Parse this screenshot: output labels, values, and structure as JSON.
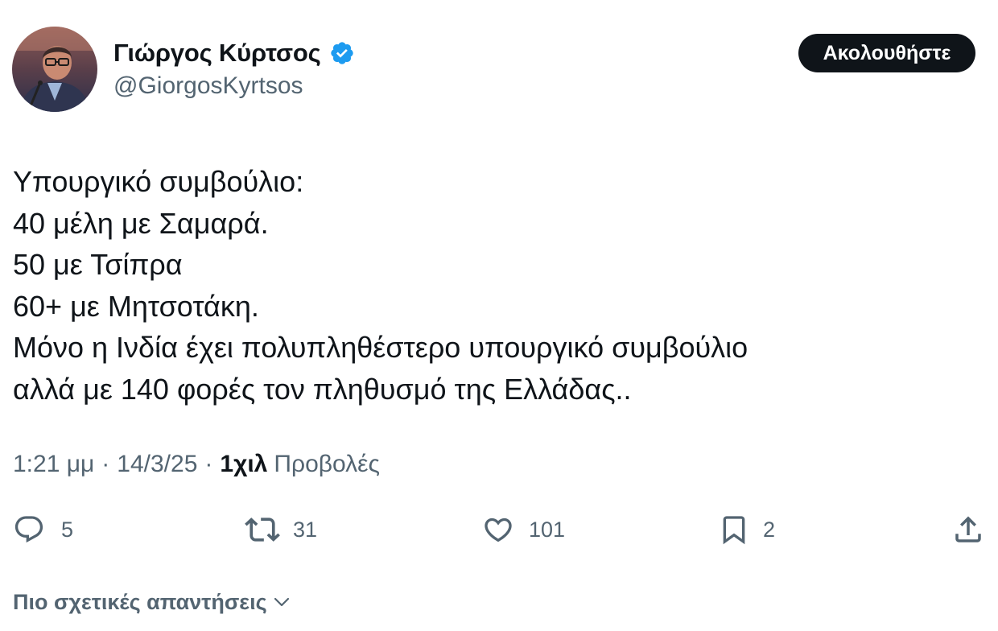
{
  "author": {
    "display_name": "Γιώργος Κύρτσος",
    "handle": "@GiorgosKyrtsos",
    "verified": true,
    "verified_color": "#1d9bf0",
    "avatar_icon": "profile-photo"
  },
  "follow_button": {
    "label": "Ακολουθήστε",
    "background": "#0f1419",
    "text_color": "#ffffff"
  },
  "tweet": {
    "lines": [
      "Υπουργικό συμβούλιο:",
      "40 μέλη με Σαμαρά.",
      "50 με Τσίπρα",
      "60+ με Μητσοτάκη.",
      "Μόνο η Ινδία έχει πολυπληθέστερο υπουργικό συμβούλιο",
      "αλλά με 140 φορές τον πληθυσμό της Ελλάδας.."
    ]
  },
  "meta": {
    "time": "1:21 μμ",
    "separator": "·",
    "date": "14/3/25",
    "views_count": "1χιλ",
    "views_label": "Προβολές"
  },
  "actions": {
    "replies": {
      "icon": "reply-icon",
      "count": "5"
    },
    "retweets": {
      "icon": "retweet-icon",
      "count": "31"
    },
    "likes": {
      "icon": "heart-icon",
      "count": "101"
    },
    "bookmarks": {
      "icon": "bookmark-icon",
      "count": "2"
    },
    "share": {
      "icon": "share-icon"
    }
  },
  "more_replies": {
    "label": "Πιο σχετικές απαντήσεις",
    "icon": "chevron-down-icon"
  },
  "colors": {
    "text_primary": "#0f1419",
    "text_secondary": "#536471"
  }
}
